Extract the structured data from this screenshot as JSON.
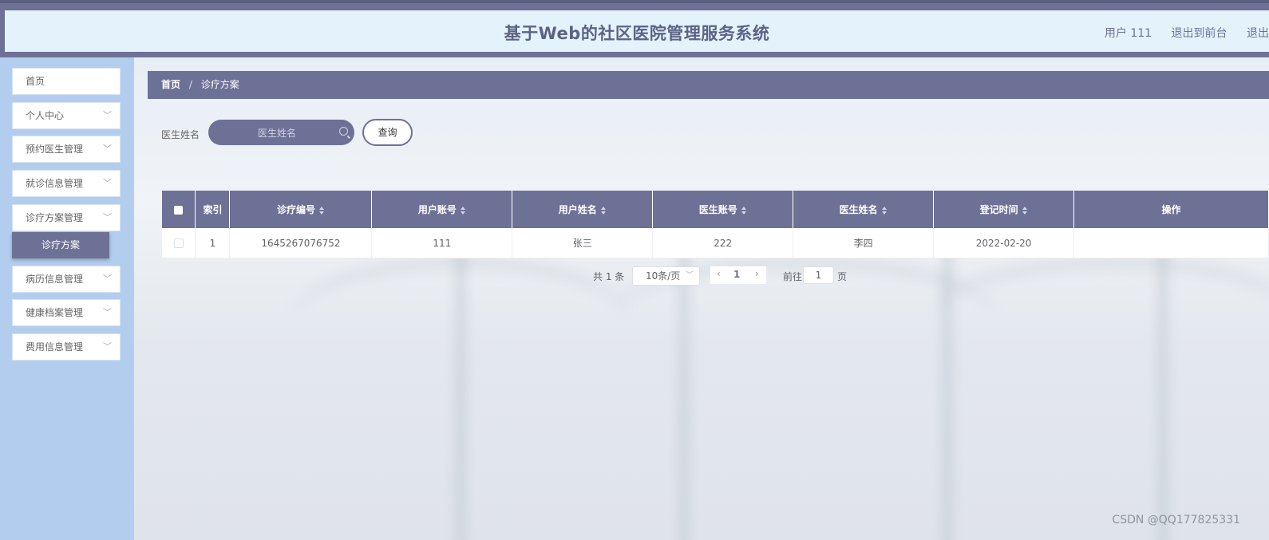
{
  "header": {
    "title": "基于Web的社区医院管理服务系统",
    "user": "用户 111",
    "back_to_front": "退出到前台",
    "logout": "退出"
  },
  "sidebar": {
    "items": [
      {
        "label": "首页"
      },
      {
        "label": "个人中心"
      },
      {
        "label": "预约医生管理"
      },
      {
        "label": "就诊信息管理"
      },
      {
        "label": "诊疗方案管理"
      },
      {
        "label": "病历信息管理"
      },
      {
        "label": "健康档案管理"
      },
      {
        "label": "费用信息管理"
      }
    ],
    "active_sub": "诊疗方案"
  },
  "breadcrumb": {
    "home": "首页",
    "sep": "/",
    "current": "诊疗方案"
  },
  "search": {
    "label": "医生姓名",
    "placeholder": "医生姓名",
    "button": "查询"
  },
  "table": {
    "columns": [
      "索引",
      "诊疗编号",
      "用户账号",
      "用户姓名",
      "医生账号",
      "医生姓名",
      "登记时间",
      "操作"
    ],
    "rows": [
      {
        "index": "1",
        "code": "1645267076752",
        "user_account": "111",
        "user_name": "张三",
        "doctor_account": "222",
        "doctor_name": "李四",
        "time": "2022-02-20",
        "ops": ""
      }
    ]
  },
  "pagination": {
    "total": "共 1 条",
    "page_size": "10条/页",
    "current_page": "1",
    "goto_label": "前往",
    "goto_value": "1",
    "page_suffix": "页"
  },
  "watermark": "CSDN @QQ177825331",
  "colors": {
    "primary": "#6e7196",
    "sidebar_bg": "#b3cdef",
    "header_bg": "#e4f2fc"
  }
}
